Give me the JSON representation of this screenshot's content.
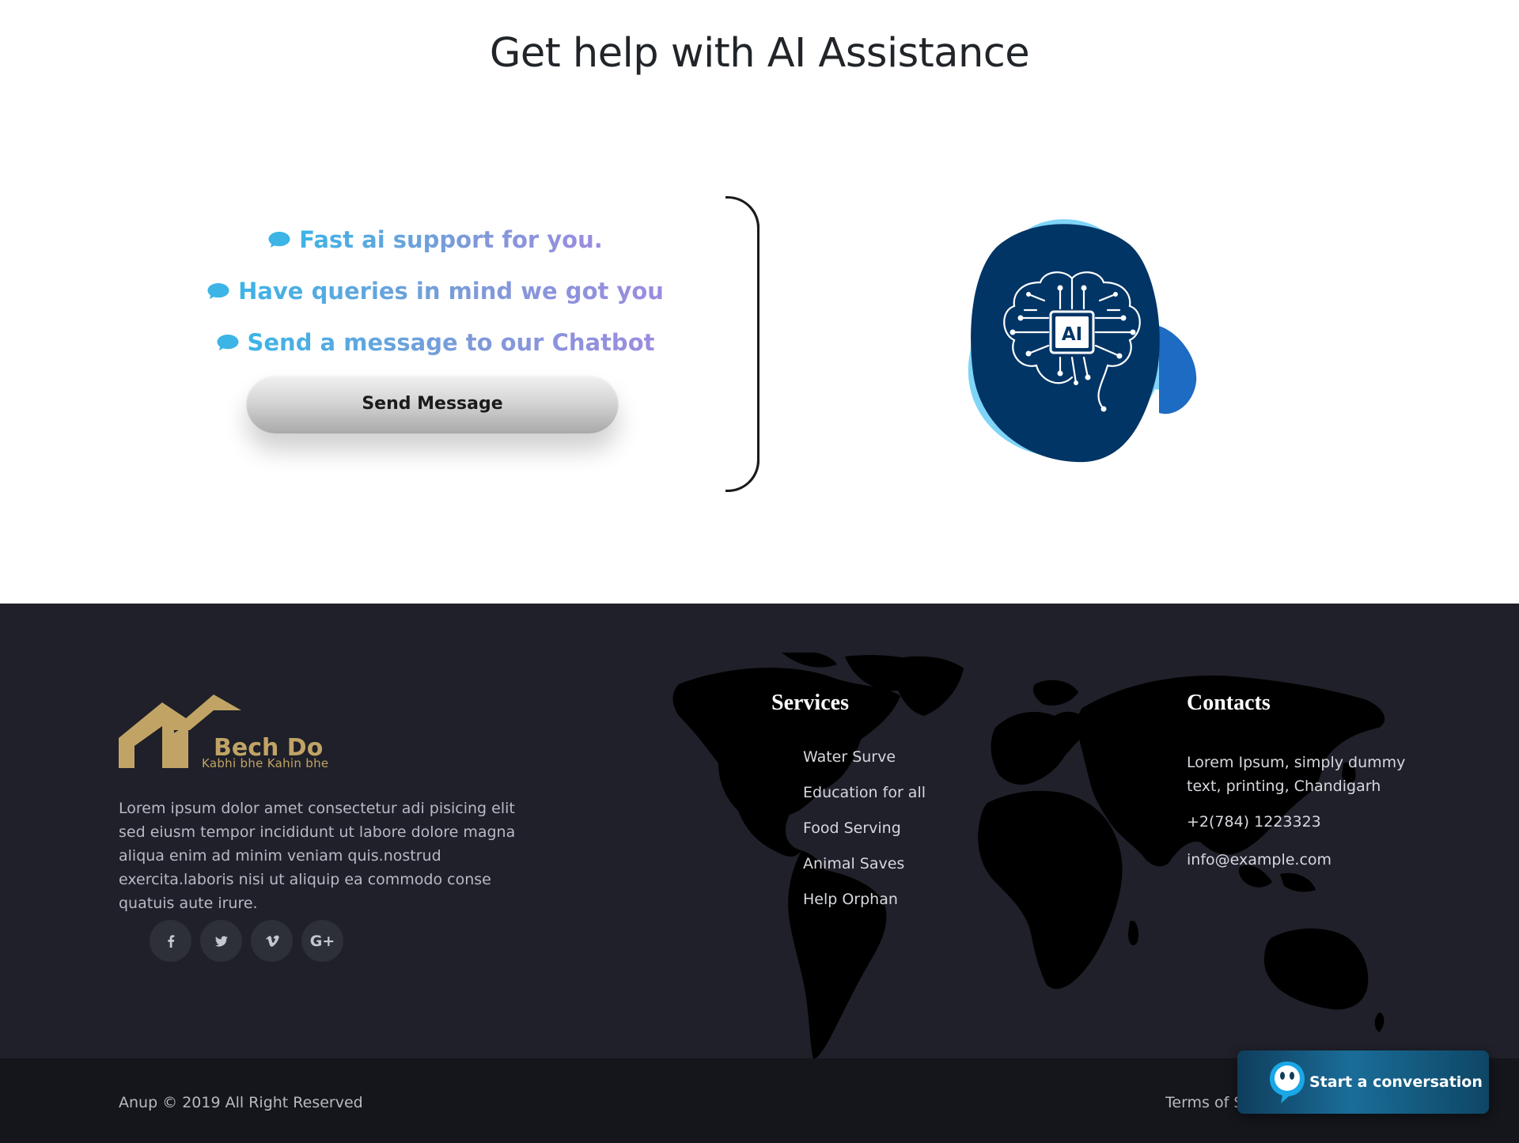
{
  "hero": {
    "title": "Get help with AI Assistance",
    "features": [
      {
        "icon": "chat-bubble-icon",
        "text": "Fast ai support for you."
      },
      {
        "icon": "chat-bubble-icon",
        "text": "Have queries in mind we got you"
      },
      {
        "icon": "chat-bubble-icon",
        "text": "Send a message to our Chatbot"
      }
    ],
    "send_button": "Send Message",
    "ai_badge": "AI"
  },
  "footer": {
    "brand": {
      "name": "Bech Do",
      "tagline": "Kabhi bhe Kahin bhe"
    },
    "about": "Lorem ipsum dolor amet consectetur adi pisicing elit sed eiusm tempor incididunt ut labore dolore magna aliqua enim ad minim veniam quis.nostrud exercita.laboris nisi ut aliquip ea commodo conse quatuis aute irure.",
    "socials": [
      {
        "icon": "facebook-icon"
      },
      {
        "icon": "twitter-icon"
      },
      {
        "icon": "vimeo-icon"
      },
      {
        "icon": "google-plus-icon",
        "label": "G+"
      }
    ],
    "services": {
      "title": "Services",
      "items": [
        "Water Surve",
        "Education for all",
        "Food Serving",
        "Animal Saves",
        "Help Orphan"
      ]
    },
    "contacts": {
      "title": "Contacts",
      "address": "Lorem Ipsum, simply dummy text, printing, Chandigarh",
      "phone": "+2(784) 1223323",
      "email": "info@example.com"
    },
    "copyright": "Anup © 2019 All Right Reserved",
    "terms": "Terms of S"
  },
  "chat_widget": {
    "label": "Start a conversation",
    "icon": "chatbot-face-icon"
  },
  "colors": {
    "footer_bg": "#1f2029",
    "bottom_bg": "#15161c",
    "brand_gold": "#c1a465",
    "feature_gradient_start": "#3cb4e6",
    "feature_gradient_end": "#9b8ce0",
    "ai_blob_dark": "#003566",
    "ai_blob_light": "#7fd4f7"
  }
}
